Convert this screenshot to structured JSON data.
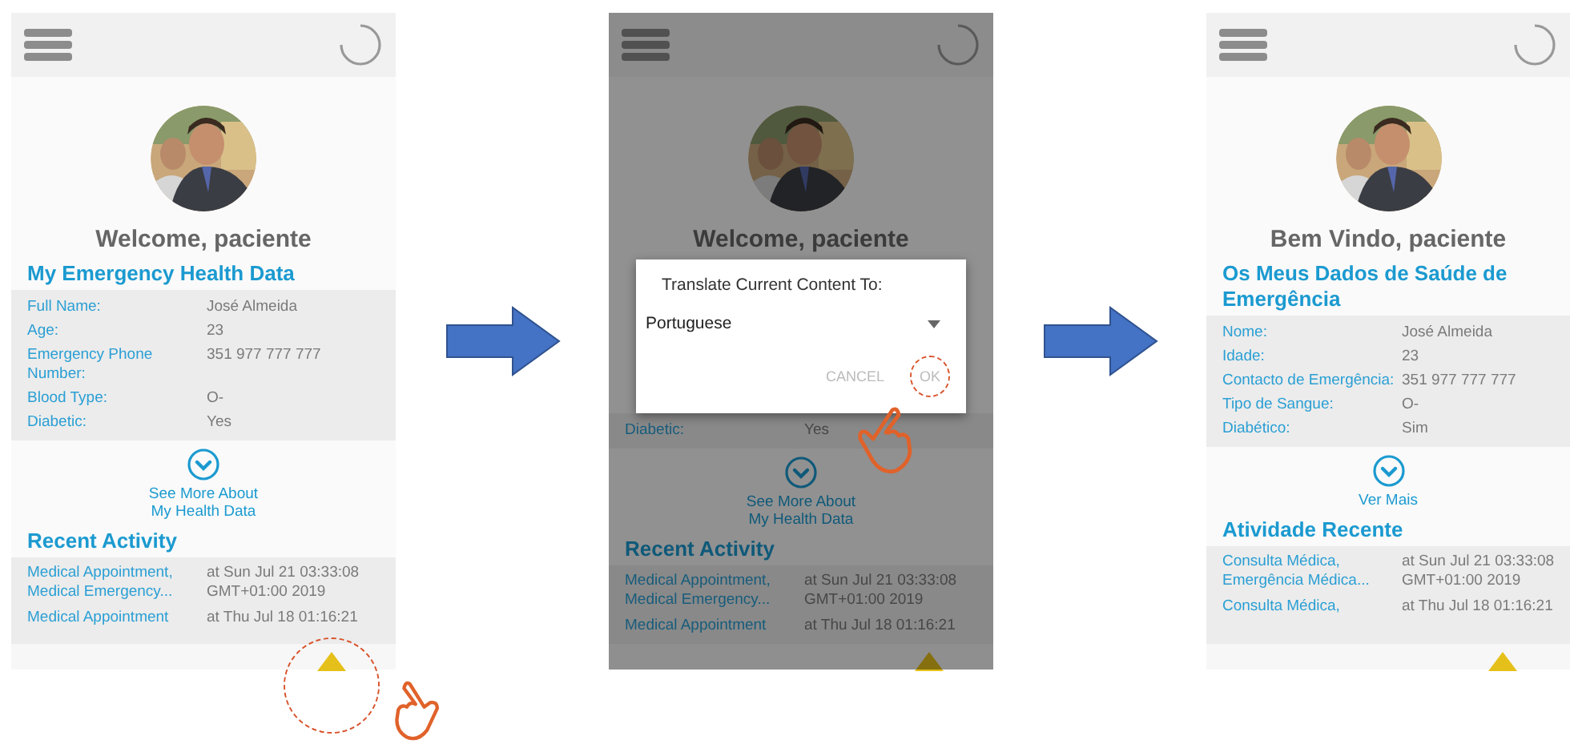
{
  "screens": [
    {
      "dimmed": false,
      "welcome": "Welcome, paciente",
      "section_title": "My Emergency Health Data",
      "rows": [
        {
          "label": "Full Name:",
          "value": "José Almeida"
        },
        {
          "label": "Age:",
          "value": "23"
        },
        {
          "label": "Emergency Phone\nNumber:",
          "value": "351 977 777 777"
        },
        {
          "label": "Blood Type:",
          "value": "O-"
        },
        {
          "label": "Diabetic:",
          "value": "Yes"
        }
      ],
      "see_more": "See More About\nMy Health Data",
      "activity_title": "Recent Activity",
      "activity": [
        {
          "title": "Medical Appointment,\nMedical Emergency...",
          "time": "at Sun Jul 21 03:33:08\nGMT+01:00 2019"
        },
        {
          "title": "Medical Appointment",
          "time": "at Thu Jul 18 01:16:21"
        }
      ],
      "scroll_tapped": true
    },
    {
      "dimmed": true,
      "welcome": "Welcome, paciente",
      "dialog": {
        "title": "Translate Current Content To:",
        "language": "Portuguese",
        "buttons": [
          {
            "label": "CANCEL",
            "tapped": false
          },
          {
            "label": "OK",
            "tapped": true
          }
        ]
      },
      "rows": [
        {
          "label": "Diabetic:",
          "value": "Yes"
        }
      ],
      "see_more": "See More About\nMy Health Data",
      "activity_title": "Recent Activity",
      "activity": [
        {
          "title": "Medical Appointment,\nMedical Emergency...",
          "time": "at Sun Jul 21 03:33:08\nGMT+01:00 2019"
        },
        {
          "title": "Medical Appointment",
          "time": "at Thu Jul 18 01:16:21"
        }
      ],
      "scroll_tapped": false
    },
    {
      "dimmed": false,
      "welcome": "Bem Vindo, paciente",
      "section_title": "Os Meus Dados de Saúde de Emergência",
      "rows": [
        {
          "label": "Nome:",
          "value": "José Almeida"
        },
        {
          "label": "Idade:",
          "value": "23"
        },
        {
          "label": "Contacto de Emergência:",
          "value": "351 977 777 777"
        },
        {
          "label": "Tipo de Sangue:",
          "value": "O-"
        },
        {
          "label": "Diabético:",
          "value": "Sim"
        }
      ],
      "see_more": "Ver Mais",
      "activity_title": "Atividade Recente",
      "activity": [
        {
          "title": "Consulta Médica,\nEmergência Médica...",
          "time": "at Sun Jul 21 03:33:08\nGMT+01:00 2019"
        },
        {
          "title": "Consulta Médica,",
          "time": "at Thu Jul 18 01:16:21"
        }
      ],
      "scroll_tapped": false
    }
  ]
}
